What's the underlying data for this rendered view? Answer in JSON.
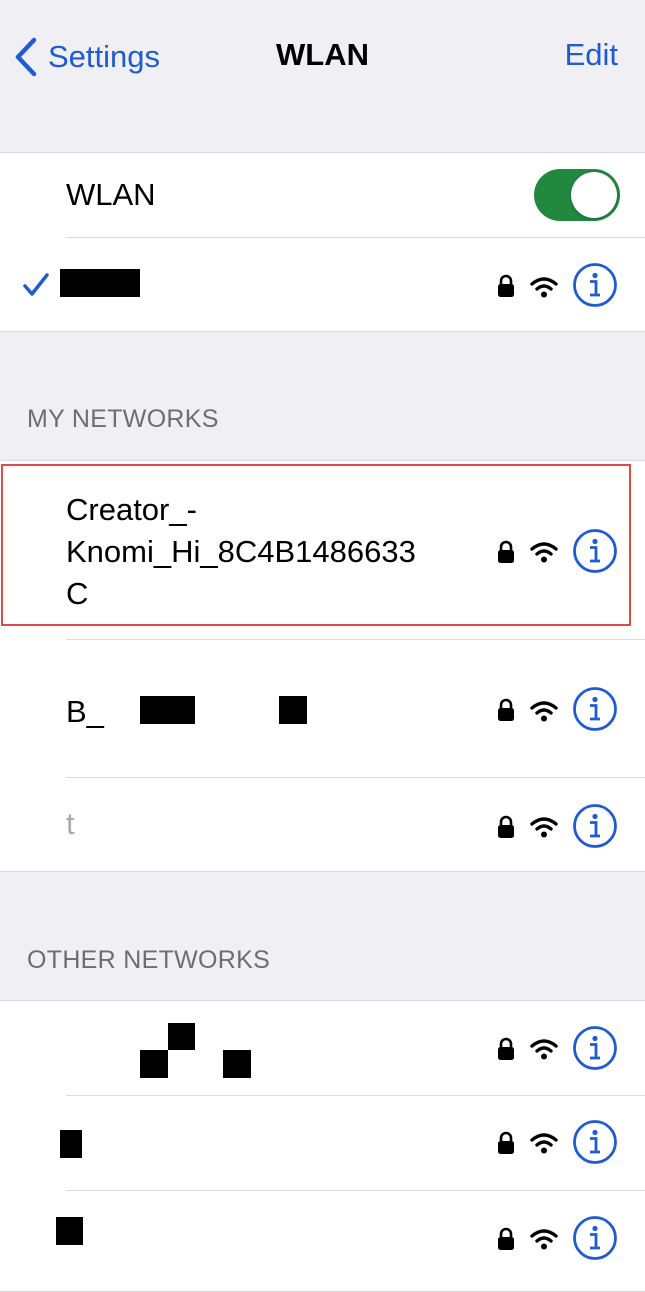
{
  "nav": {
    "back_label": "Settings",
    "title": "WLAN",
    "edit_label": "Edit"
  },
  "wlan": {
    "toggle_label": "WLAN",
    "toggle_on": true,
    "connected_network": ""
  },
  "my_networks": {
    "header": "MY NETWORKS",
    "items": [
      {
        "name": "Creator_-\nKnomi_Hi_8C4B1486633\nC",
        "secured": true
      },
      {
        "name": "B_",
        "secured": true
      },
      {
        "name": "t",
        "secured": true
      }
    ]
  },
  "other_networks": {
    "header": "OTHER NETWORKS",
    "items": [
      {
        "name": "",
        "secured": true
      },
      {
        "name": "",
        "secured": true
      },
      {
        "name": "",
        "secured": true
      }
    ]
  },
  "icons": {
    "back": "chevron-left-icon",
    "lock": "lock-icon",
    "wifi": "wifi-icon",
    "info": "info-icon",
    "check": "checkmark-icon"
  },
  "colors": {
    "accent": "#1f5bd1",
    "toggle_on": "#22883f",
    "highlight": "#e04a4a"
  }
}
